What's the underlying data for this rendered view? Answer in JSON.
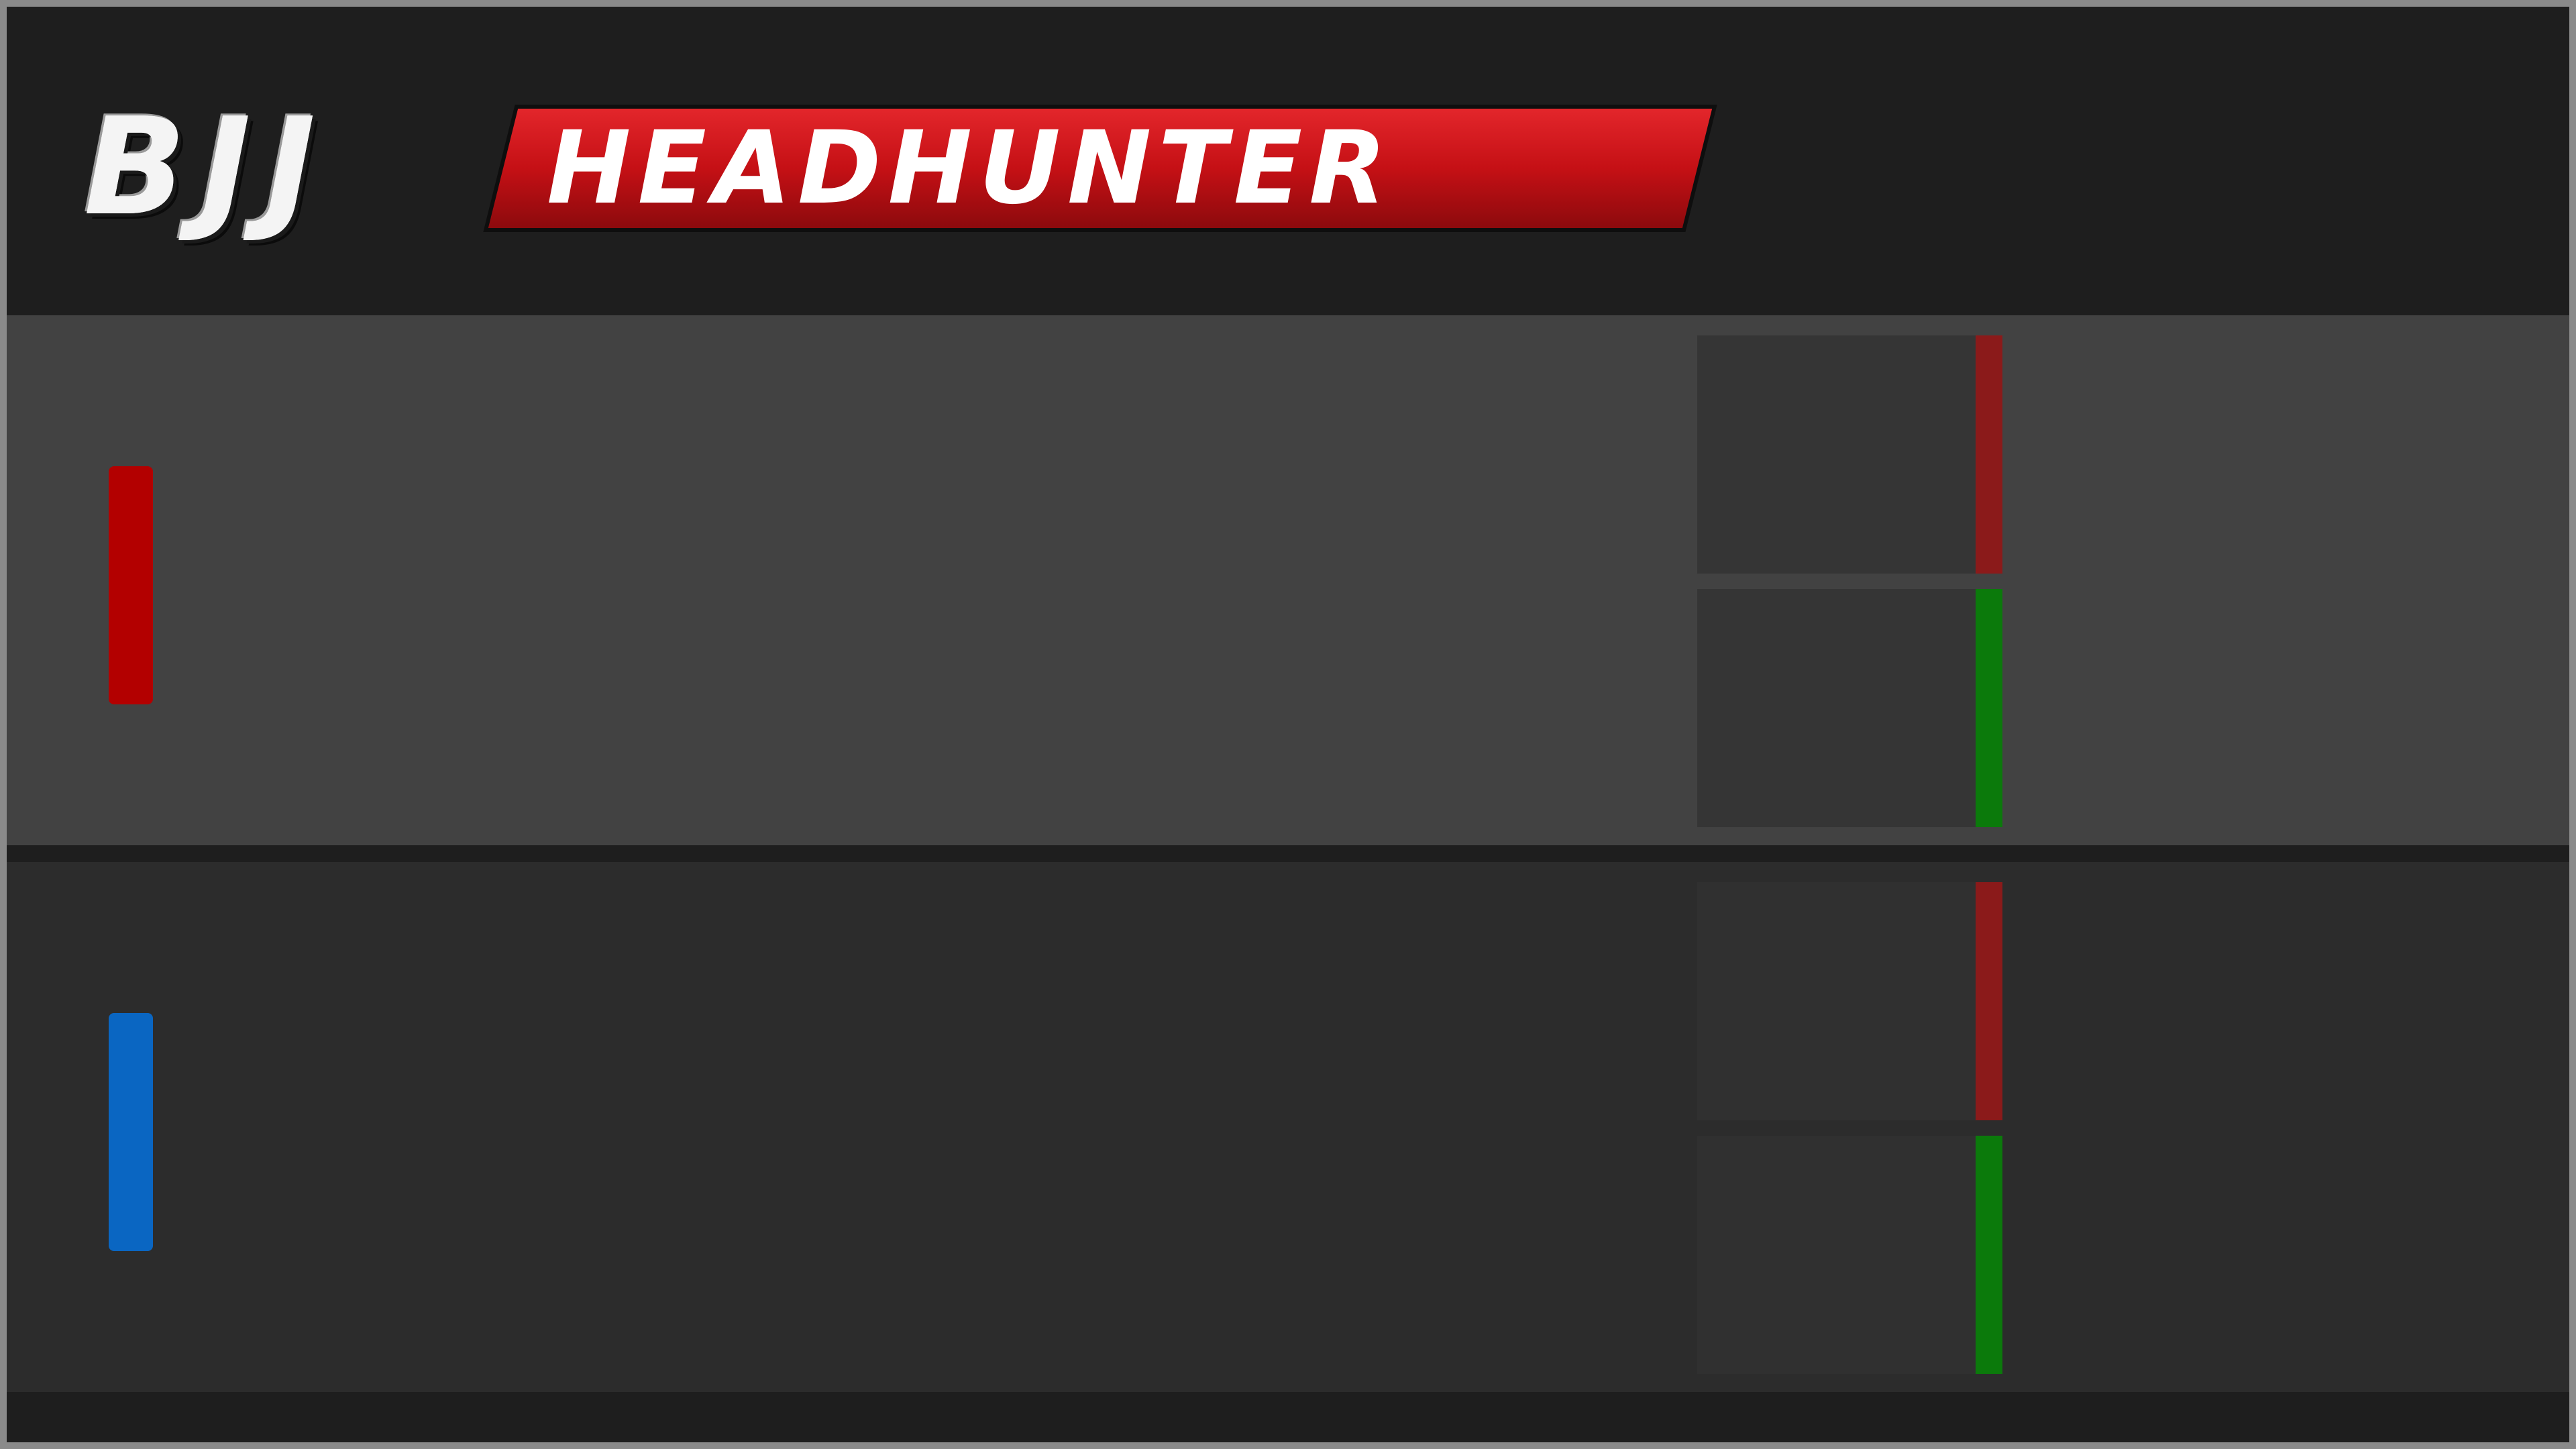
{
  "logo": {
    "part1": "BJJ",
    "part2": "HEADHUNTER",
    "accent_color": "#d11318"
  },
  "competitors": [
    {
      "corner": "red",
      "indicator_color": "#b30000",
      "name": "",
      "scores": [
        {
          "type": "penalty",
          "stripe_color": "#8b1a1a",
          "value": ""
        },
        {
          "type": "points",
          "stripe_color": "#0b7a0b",
          "value": ""
        }
      ]
    },
    {
      "corner": "blue",
      "indicator_color": "#0a66c2",
      "name": "",
      "scores": [
        {
          "type": "penalty",
          "stripe_color": "#8b1a1a",
          "value": ""
        },
        {
          "type": "points",
          "stripe_color": "#0b7a0b",
          "value": ""
        }
      ]
    }
  ]
}
